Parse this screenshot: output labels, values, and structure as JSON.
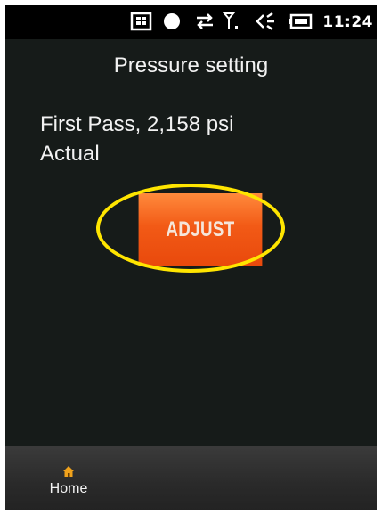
{
  "status_bar": {
    "icons": [
      "windows-start-icon",
      "record-dot-icon",
      "data-sync-icon",
      "signal-icon",
      "volume-icon",
      "battery-icon"
    ],
    "time": "11:24"
  },
  "screen": {
    "title": "Pressure setting",
    "info_line_1": "First Pass, 2,158 psi",
    "info_line_2": "Actual",
    "adjust_label": "ADJUST",
    "button_color": "#f25a16",
    "highlight_color": "#ffe500"
  },
  "menu_bar": {
    "home_label": "Home",
    "home_icon": "home-icon"
  }
}
